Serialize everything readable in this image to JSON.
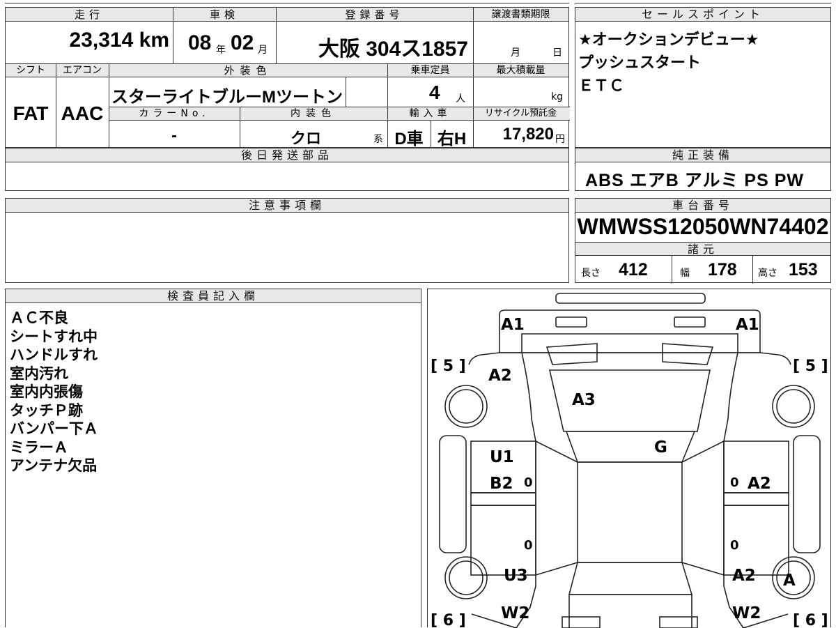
{
  "top_left": {
    "headers": {
      "mileage": "走行",
      "inspection": "車検",
      "registration": "登録番号",
      "transfer_deadline": "譲渡書類期限",
      "shift": "シフト",
      "aircon": "エアコン",
      "exterior_color": "外装色",
      "capacity": "乗車定員",
      "max_load": "最大積載量",
      "color_no": "カラーNo.",
      "interior_color": "内装色",
      "import": "輸入車",
      "recycle": "リサイクル預託金"
    },
    "mileage": "23,314 km",
    "inspection_year": "08",
    "inspection_year_unit": "年",
    "inspection_month": "02",
    "inspection_month_unit": "月",
    "registration_number": "大阪 304ス1857",
    "deadline_month_unit": "月",
    "deadline_day_unit": "日",
    "shift": "FAT",
    "aircon": "AAC",
    "exterior_color": "スターライトブルーMツートン",
    "capacity": "4",
    "capacity_unit": "人",
    "max_load_unit": "kg",
    "color_no": "-",
    "interior_color": "クロ",
    "interior_color_suffix": "系",
    "import_type": "D車",
    "steering": "右H",
    "recycle_fee": "17,820",
    "recycle_unit": "円"
  },
  "later_parts": {
    "header": "後日発送部品"
  },
  "notes": {
    "header": "注意事項欄"
  },
  "sales_points": {
    "header": "セールスポイント",
    "lines": [
      "★オークションデビュー★",
      "プッシュスタート",
      "ＥＴＣ"
    ]
  },
  "equipment": {
    "header": "純正装備",
    "items": "ABS エアB アルミ PS PW"
  },
  "chassis": {
    "header": "車台番号",
    "number": "WMWSS12050WN74402"
  },
  "specs": {
    "header": "諸元",
    "length_label": "長さ",
    "length": "412",
    "width_label": "幅",
    "width": "178",
    "height_label": "高さ",
    "height": "153"
  },
  "inspector": {
    "header": "検査員記入欄",
    "lines": [
      "ＡＣ不良",
      "シートすれ中",
      "ハンドルすれ",
      "室内汚れ",
      "室内内張傷",
      "タッチＰ跡",
      "バンパー下Ａ",
      "ミラーＡ",
      "アンテナ欠品"
    ]
  },
  "diagram": {
    "marks": {
      "a1_left": "A1",
      "a1_right": "A1",
      "bracket_5_left": "[ 5 ]",
      "bracket_5_right": "[ 5 ]",
      "a2_front_left": "A2",
      "a3": "A3",
      "g": "G",
      "u1": "U1",
      "b2": "B2",
      "a2_right_door": "A2",
      "zero_1": "0",
      "zero_2": "0",
      "zero_3": "0",
      "zero_4": "0",
      "u3": "U3",
      "a2_rear_right": "A2",
      "a_wheel": "A",
      "bracket_6_left": "[ 6 ]",
      "bracket_6_right": "[ 6 ]",
      "w2_left": "W2",
      "w2_right": "W2"
    }
  }
}
